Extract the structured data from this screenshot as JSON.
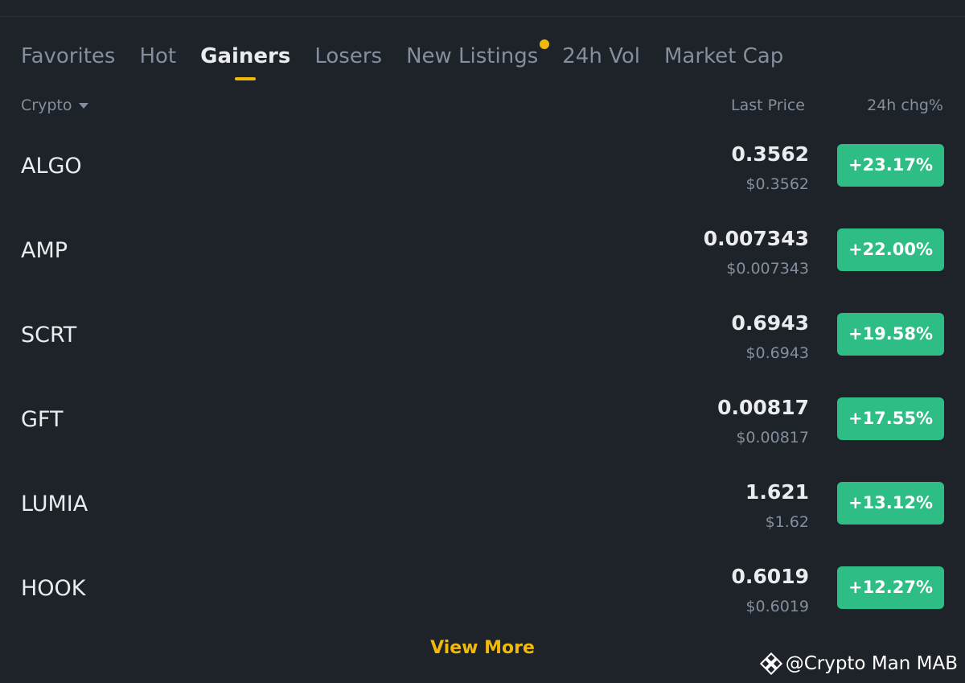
{
  "tabs": [
    {
      "label": "Favorites",
      "active": false
    },
    {
      "label": "Hot",
      "active": false
    },
    {
      "label": "Gainers",
      "active": true
    },
    {
      "label": "Losers",
      "active": false
    },
    {
      "label": "New Listings",
      "active": false,
      "notification_dot": true
    },
    {
      "label": "24h Vol",
      "active": false
    },
    {
      "label": "Market Cap",
      "active": false
    }
  ],
  "headers": {
    "crypto": "Crypto",
    "last_price": "Last Price",
    "change": "24h chg%"
  },
  "rows": [
    {
      "symbol": "ALGO",
      "price": "0.3562",
      "usd": "$0.3562",
      "change": "+23.17%"
    },
    {
      "symbol": "AMP",
      "price": "0.007343",
      "usd": "$0.007343",
      "change": "+22.00%"
    },
    {
      "symbol": "SCRT",
      "price": "0.6943",
      "usd": "$0.6943",
      "change": "+19.58%"
    },
    {
      "symbol": "GFT",
      "price": "0.00817",
      "usd": "$0.00817",
      "change": "+17.55%"
    },
    {
      "symbol": "LUMIA",
      "price": "1.621",
      "usd": "$1.62",
      "change": "+13.12%"
    },
    {
      "symbol": "HOOK",
      "price": "0.6019",
      "usd": "$0.6019",
      "change": "+12.27%"
    }
  ],
  "view_more": "View More",
  "watermark": {
    "text": "@Crypto Man MAB",
    "icon": "binance-logo-icon"
  },
  "colors": {
    "background": "#1e2329",
    "accent": "#f0b90b",
    "positive": "#2ebd85",
    "text_primary": "#eaecef",
    "text_secondary": "#848e9c"
  }
}
